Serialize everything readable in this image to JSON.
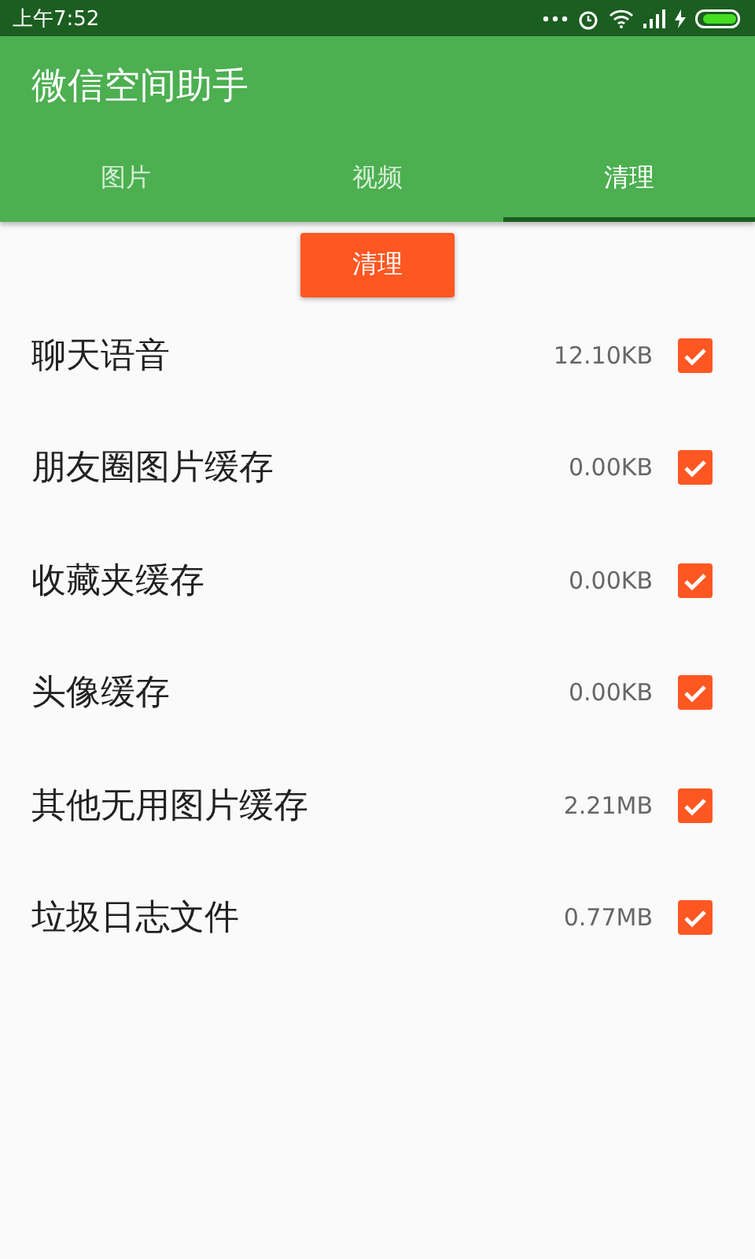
{
  "status_bar": {
    "time": "上午7:52"
  },
  "app_bar": {
    "title": "微信空间助手"
  },
  "tabs": [
    {
      "label": "图片",
      "selected": false
    },
    {
      "label": "视频",
      "selected": false
    },
    {
      "label": "清理",
      "selected": true
    }
  ],
  "clean_button": "清理",
  "items": [
    {
      "name": "聊天语音",
      "size": "12.10KB",
      "checked": true
    },
    {
      "name": "朋友圈图片缓存",
      "size": "0.00KB",
      "checked": true
    },
    {
      "name": "收藏夹缓存",
      "size": "0.00KB",
      "checked": true
    },
    {
      "name": "头像缓存",
      "size": "0.00KB",
      "checked": true
    },
    {
      "name": "其他无用图片缓存",
      "size": "2.21MB",
      "checked": true
    },
    {
      "name": "垃圾日志文件",
      "size": "0.77MB",
      "checked": true
    }
  ]
}
